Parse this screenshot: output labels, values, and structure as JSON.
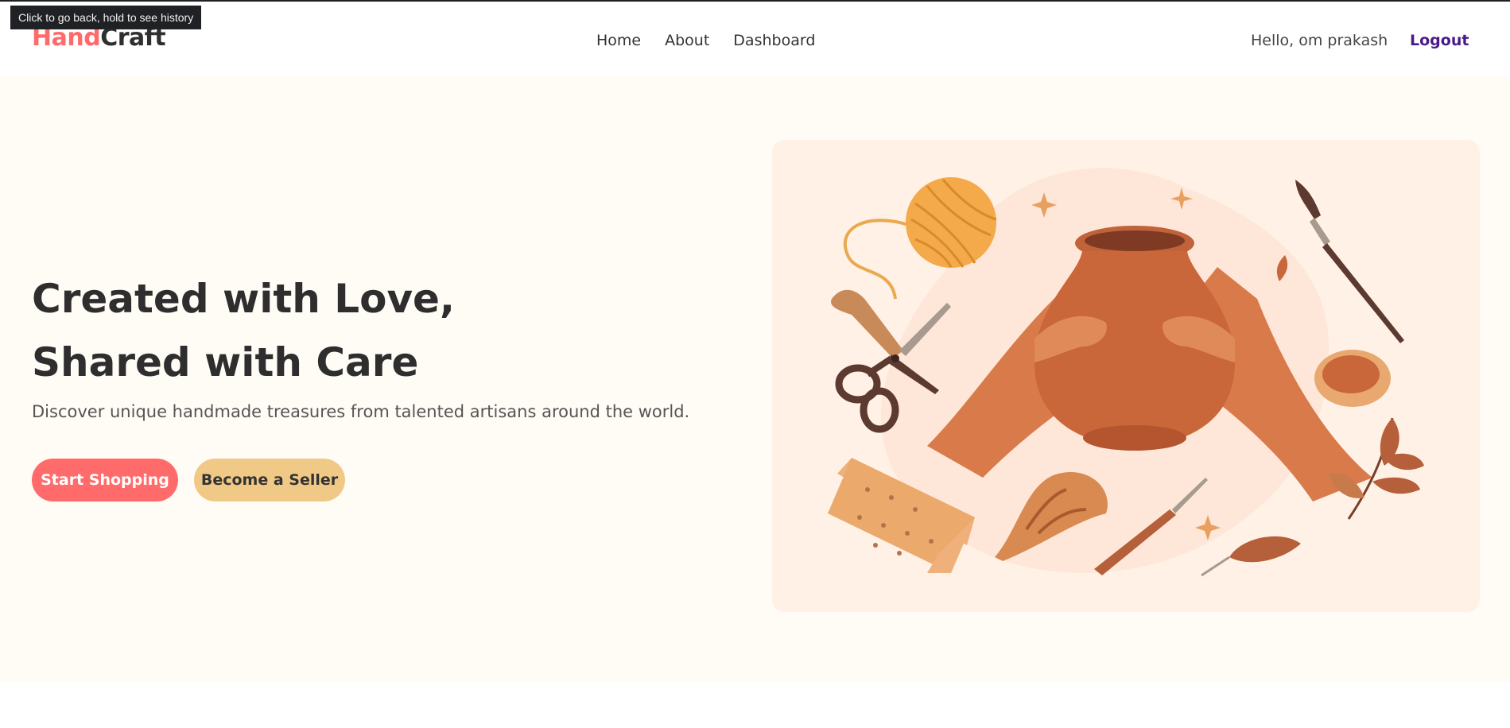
{
  "browser": {
    "tooltip": "Click to go back, hold to see history"
  },
  "header": {
    "logo": {
      "part1": "Hand",
      "part2": "Craft"
    },
    "nav": [
      {
        "label": "Home"
      },
      {
        "label": "About"
      },
      {
        "label": "Dashboard"
      }
    ],
    "greeting": "Hello, om prakash",
    "logout_label": "Logout"
  },
  "hero": {
    "title_line1": "Created with Love,",
    "title_line2": "Shared with Care",
    "tagline": "Discover unique handmade treasures from talented artisans around the world.",
    "primary_button": "Start Shopping",
    "secondary_button": "Become a Seller"
  },
  "colors": {
    "brand_accent": "#ff6b6b",
    "secondary_button": "#f0c987",
    "logout": "#4a1a8c",
    "hero_background": "#fffbf5"
  },
  "icons": [
    "yarn-ball-icon",
    "scissors-icon",
    "clay-pot-icon",
    "paintbrush-icon",
    "leaf-branch-icon",
    "clay-bowl-icon",
    "sandpaper-icon",
    "carving-tool-icon",
    "sparkle-icon"
  ]
}
